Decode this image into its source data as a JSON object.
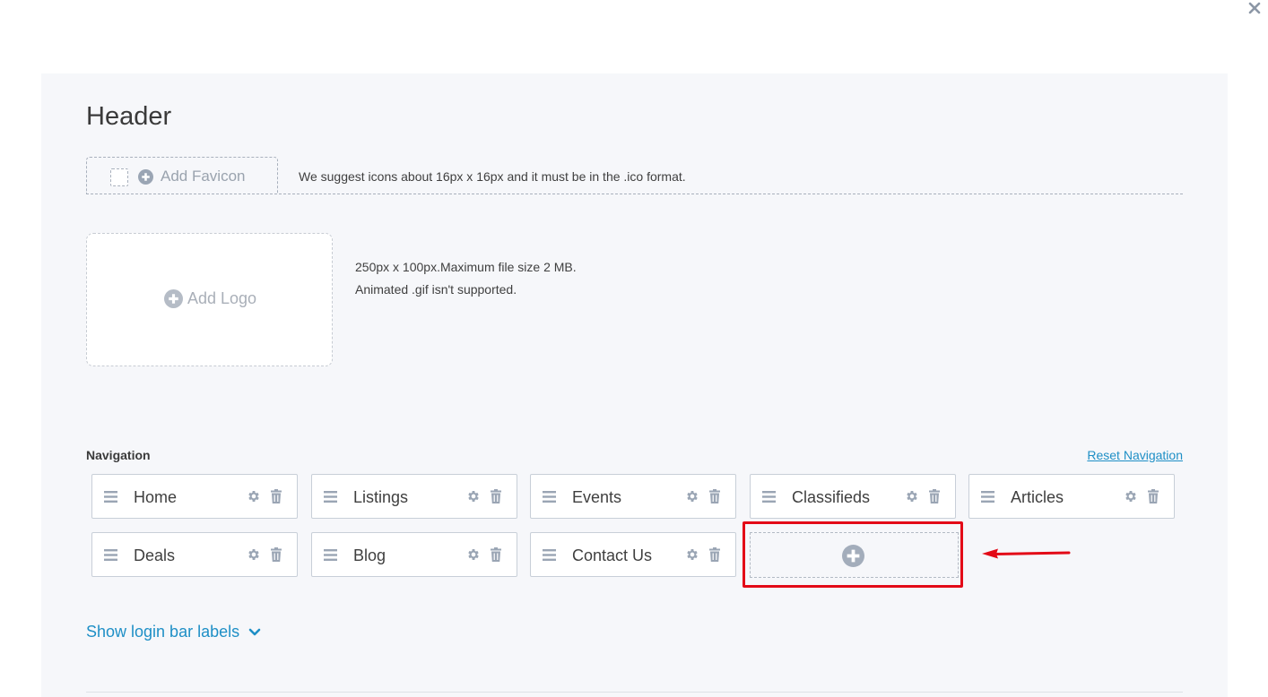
{
  "page": {
    "title": "Header"
  },
  "favicon": {
    "add_label": "Add Favicon",
    "hint": "We suggest icons about 16px x 16px and it must be in the .ico format."
  },
  "logo": {
    "add_label": "Add Logo",
    "hint_line1": "250px x 100px.Maximum file size 2 MB.",
    "hint_line2": "Animated .gif isn't supported."
  },
  "navigation": {
    "label": "Navigation",
    "reset_label": "Reset Navigation",
    "items": [
      {
        "label": "Home"
      },
      {
        "label": "Listings"
      },
      {
        "label": "Events"
      },
      {
        "label": "Classifieds"
      },
      {
        "label": "Articles"
      },
      {
        "label": "Deals"
      },
      {
        "label": "Blog"
      },
      {
        "label": "Contact Us"
      }
    ]
  },
  "login_bar": {
    "label": "Show login bar labels"
  },
  "icons": {
    "close": "close-icon",
    "plus_circle": "plus-circle-icon",
    "drag": "drag-handle-icon",
    "gear": "gear-icon",
    "trash": "trash-icon",
    "chevron": "chevron-down-icon"
  },
  "colors": {
    "accent": "#1e8fc6",
    "panel_bg": "#f6f7fa",
    "icon_gray": "#9aa5b4",
    "highlight": "#e30a17"
  }
}
